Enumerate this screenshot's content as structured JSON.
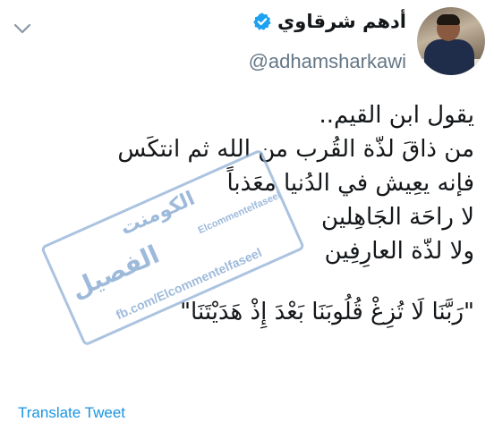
{
  "author": {
    "display_name": "أدهم شرقاوي",
    "handle": "@adhamsharkawi",
    "verified": true
  },
  "icons": {
    "menu": "chevron-down-icon",
    "verified": "verified-badge-icon"
  },
  "tweet": {
    "lines": [
      "يقول ابن القيم..",
      "من ذاقَ لذّة القُرب من الله ثم انتكَس",
      "فإنه يعِيش في الدُنيا معَذباً",
      "لا راحَة الجَاهِلين",
      "ولا لذّة العارِفِين"
    ],
    "verse": "\"رَبَّنَا لَا تُزِغْ قُلُوبَنَا بَعْدَ إِذْ هَدَيْتَنَا\""
  },
  "actions": {
    "translate_label": "Translate Tweet"
  },
  "watermark": {
    "top_text": "الكومنت",
    "main_text": "الفصيل",
    "side_text": "Elcommentelfaseel",
    "bottom_text": "fb.com/Elcommentelfaseel"
  },
  "colors": {
    "link": "#1b95e0",
    "verified": "#1da1f2",
    "secondary_text": "#657786",
    "watermark": "#7ea3cf"
  }
}
